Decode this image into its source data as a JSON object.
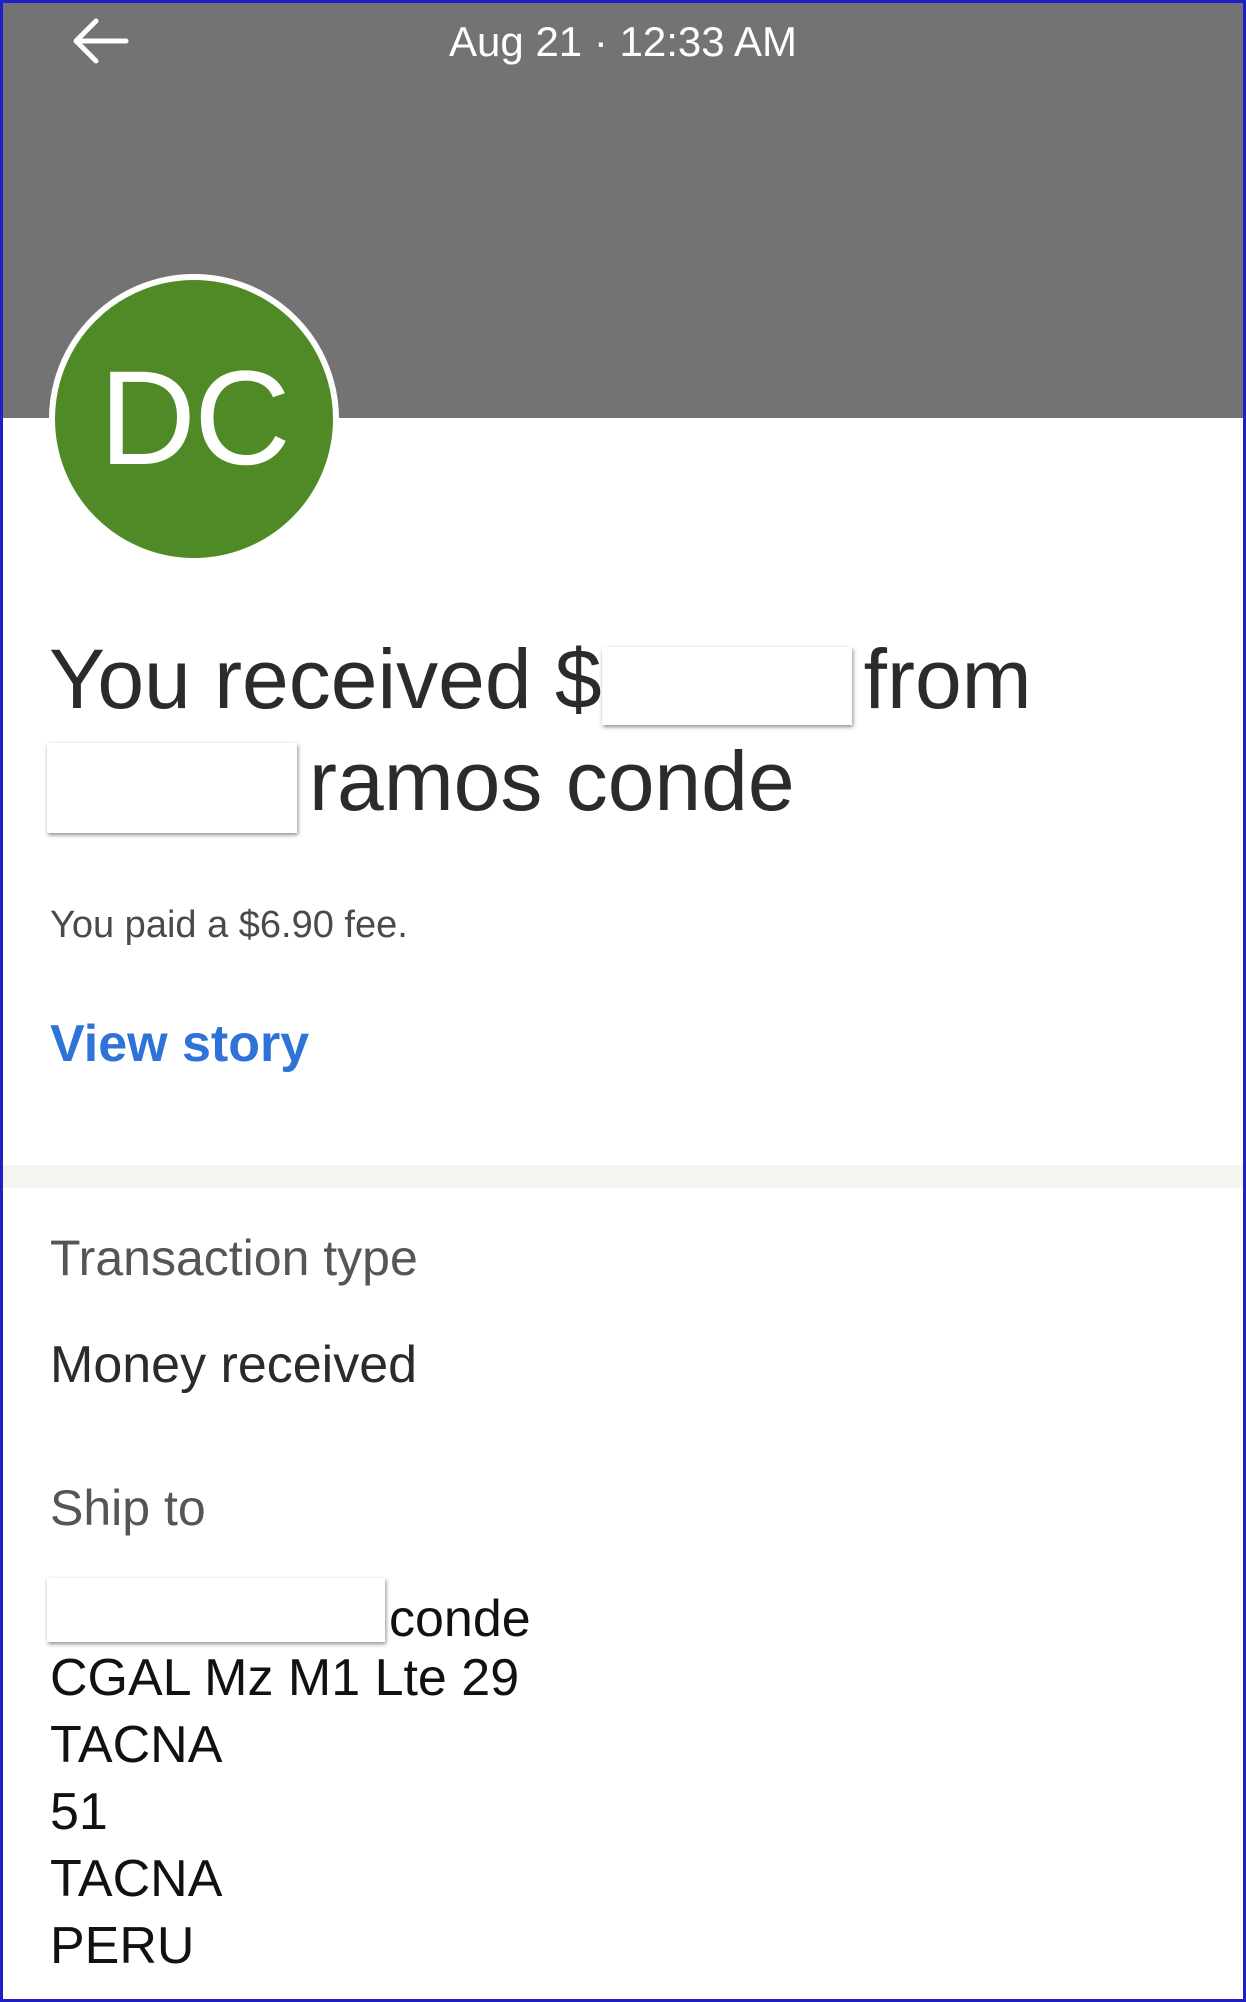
{
  "header": {
    "datetime": "Aug 21 · 12:33 AM",
    "back_icon": "arrow-left-icon",
    "background_color": "#737373"
  },
  "avatar": {
    "initials": "DC",
    "color": "#4f8a26"
  },
  "headline": {
    "part1": "You received $",
    "part2": "from",
    "part3": "ramos conde"
  },
  "fee_text": "You paid a $6.90 fee.",
  "view_story_label": "View story",
  "link_color": "#2f73d8",
  "transaction": {
    "label": "Transaction type",
    "value": "Money received"
  },
  "ship_to": {
    "label": "Ship to",
    "name_suffix": "conde",
    "lines": [
      "CGAL Mz M1 Lte 29",
      "TACNA",
      "51",
      "TACNA",
      "PERU"
    ]
  }
}
